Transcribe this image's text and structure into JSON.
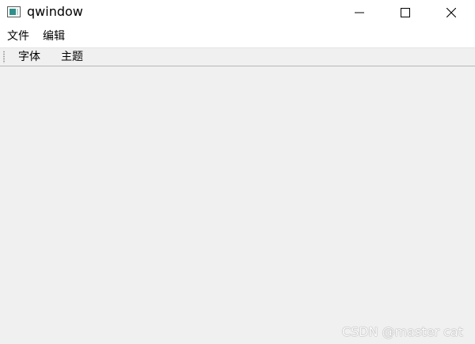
{
  "window": {
    "title": "qwindow"
  },
  "menubar": {
    "items": [
      {
        "label": "文件"
      },
      {
        "label": "编辑"
      }
    ]
  },
  "toolbar": {
    "buttons": [
      {
        "label": "字体"
      },
      {
        "label": "主题"
      }
    ]
  },
  "watermark": {
    "text": "CSDN @master cat"
  },
  "icons": {
    "app": "window-icon",
    "minimize": "minimize-icon",
    "maximize": "maximize-icon",
    "close": "close-icon"
  },
  "colors": {
    "titlebar_bg": "#ffffff",
    "client_bg": "#f0f0f0",
    "text": "#000000"
  }
}
